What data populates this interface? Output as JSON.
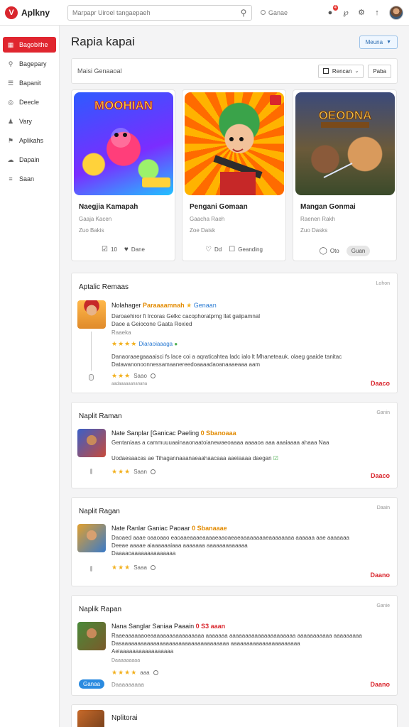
{
  "app": {
    "name": "Aplkny",
    "logo_letter": "V",
    "search_placeholder": "Marpapr Uiroel tangaepaeh",
    "lang": "Ganae",
    "notif_count": "4"
  },
  "sidebar": {
    "items": [
      {
        "label": "Bagobithe",
        "icon": "grid-icon",
        "active": true
      },
      {
        "label": "Bagepary",
        "icon": "search-icon"
      },
      {
        "label": "Bapanit",
        "icon": "list-icon"
      },
      {
        "label": "Deecle",
        "icon": "globe-icon"
      },
      {
        "label": "Vary",
        "icon": "user-icon"
      },
      {
        "label": "Aplikahs",
        "icon": "tag-icon"
      },
      {
        "label": "Dapain",
        "icon": "cloud-icon"
      },
      {
        "label": "Saan",
        "icon": "layers-icon"
      }
    ]
  },
  "page": {
    "title": "Rapia kapai",
    "header_button": "Meuna"
  },
  "filter": {
    "label": "Maisi Genaaoal",
    "button1": "Rencan",
    "button2": "Paba"
  },
  "cards": [
    {
      "title": "Naegjia Kamapah",
      "sub1": "Gaaja Kacen",
      "sub2": "Zuo Bakis",
      "action1": "10",
      "action2": "Dane"
    },
    {
      "title": "Pengani Gomaan",
      "sub1": "Gaacha Raeh",
      "sub2": "Zoe Daisk",
      "action1": "Dd",
      "action2": "Geanding"
    },
    {
      "title": "Mangan Gonmai",
      "sub1": "Raenen Rakh",
      "sub2": "Zuo Dasks",
      "action1": "Oto",
      "action2": "Guan"
    }
  ],
  "card_thumb_texts": [
    "MOOHIAN",
    "OEODNA"
  ],
  "reviews": [
    {
      "title": "Aptalic Remaas",
      "meta": "Lohon",
      "head_name": "Nolahager",
      "head_acc": "Paraaaamnah",
      "head_blue": "Genaan",
      "line1": "Daroaehiror fi Ircoras Gelkc cacophoratprng llat gaiipamnal",
      "line2": "Daoe a Geiocone Gaata Roxied",
      "line3": "Raaeka",
      "badge_line": "Diaraoiaaaga",
      "line4": "Danaoraaegaaaaisci fs lace coi a aqraticahtea ladc ialo lt Mhaneteauk. olaeg gaaide tanitac",
      "line5": "Datawanonoonnessamaanereedoaaaadaoanaaaeaaa aam",
      "rating": "Saao",
      "reply": "Daaco",
      "foot": "aadaaaaaananana"
    },
    {
      "title": "Naplit Raman",
      "meta": "Ganin",
      "head_name": "Nate Sanplar [Ganicac Paeling",
      "head_acc": "0 Sbanoaaa",
      "line1": "Gentaniaas a cammuuuaainaaonaatoianewaeoaaaa aaaaoa aaa aaaiaaaa ahaaa Naa",
      "line2": "Uodaesaacas ae Tihagannaaanaeaahaacaaa aaeiaaaa daegan",
      "rating": "Saan",
      "reply": "Daaco"
    },
    {
      "title": "Naplit Ragan",
      "meta": "Daain",
      "head_name": "Nate Ranlar Ganiac Paoaar",
      "head_acc": "0 Sbanaaae",
      "line1": "Daoaed aaae oaaoaao eaoaaeaaaeaaaaeaaoaeaeaaaaaaaaeaaaaaaaa aaaaaa aae aaaaaaa",
      "line2": "Deeae aaaae aiaaaaaaiaaa aaaaaaa aaaaaaaaaaaaa",
      "line3": "Daaaaoaaaaaaaaaaaaaa",
      "rating": "Saaa",
      "reply": "Daano"
    },
    {
      "title": "Naplik Rapan",
      "meta": "Ganie",
      "head_name": "Nana Sanglar Saniaa Paaain",
      "head_acc": "0 S3 aaan",
      "line1": "Raaeaaaaaaoeaaaaaaaaaaaaaaaaa aaaaaaa aaaaaaaaaaaaaaaaaaaaa aaaaaaaaaaa aaaaaaaaa",
      "line2": "Dasaaaaaaaaaaaaaaaaaaaaaaaaaaaaaaaaaa aaaaaaaaaaaaaaaaaaaaaa",
      "line3": "Aeiaaaaaaaaaaaaaaaaa",
      "line4": "Daaaaaaaaa",
      "rating": "aaa",
      "tag": "Ganaa",
      "tag_side": "Daaaaaaaaa",
      "reply": "Daano"
    }
  ],
  "last_item": {
    "title": "Nplitorai"
  }
}
